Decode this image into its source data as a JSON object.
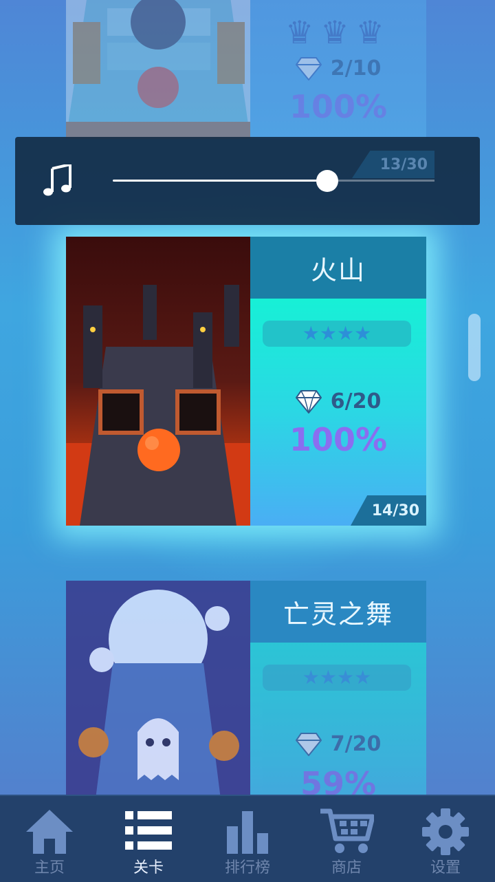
{
  "levels": [
    {
      "title": "",
      "progress_text": "2/10",
      "percent": "100%",
      "level_tag": "13/30",
      "crowns": 3
    },
    {
      "title": "火山",
      "stars_text": "★★★★",
      "stars": 4,
      "progress_text": "6/20",
      "percent": "100%",
      "level_tag": "14/30"
    },
    {
      "title": "亡灵之舞",
      "stars_text": "★★★★",
      "stars": 4,
      "progress_text": "7/20",
      "percent": "59%"
    }
  ],
  "music": {
    "icon": "music-note-icon",
    "volume": 0.69
  },
  "nav": [
    {
      "label": "主页",
      "icon": "home-icon"
    },
    {
      "label": "关卡",
      "icon": "list-icon",
      "active": true
    },
    {
      "label": "排行榜",
      "icon": "bar-chart-icon"
    },
    {
      "label": "商店",
      "icon": "cart-icon"
    },
    {
      "label": "设置",
      "icon": "gear-icon"
    }
  ],
  "colors": {
    "accent": "#17f0d6",
    "nav_bg": "#23416b",
    "percent": "#8a6ef0"
  }
}
